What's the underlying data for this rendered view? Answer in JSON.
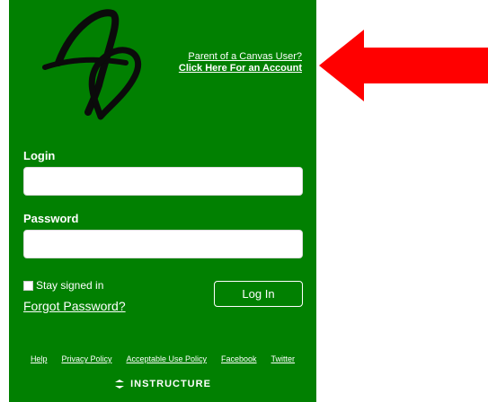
{
  "header": {
    "parent_line1": "Parent of a Canvas User?",
    "parent_line2": "Click Here For an Account"
  },
  "form": {
    "login_label": "Login",
    "login_value": "",
    "password_label": "Password",
    "password_value": "",
    "stay_signed_in_label": "Stay signed in",
    "forgot_password_label": "Forgot Password?",
    "login_button_label": "Log In"
  },
  "footer": {
    "links": [
      "Help",
      "Privacy Policy",
      "Acceptable Use Policy",
      "Facebook",
      "Twitter"
    ],
    "brand": "INSTRUCTURE"
  },
  "colors": {
    "panel_green": "#018001",
    "arrow_red": "#ff0000"
  },
  "icons": [
    "script-a-heart-logo",
    "instructure-logo",
    "red-arrow"
  ]
}
